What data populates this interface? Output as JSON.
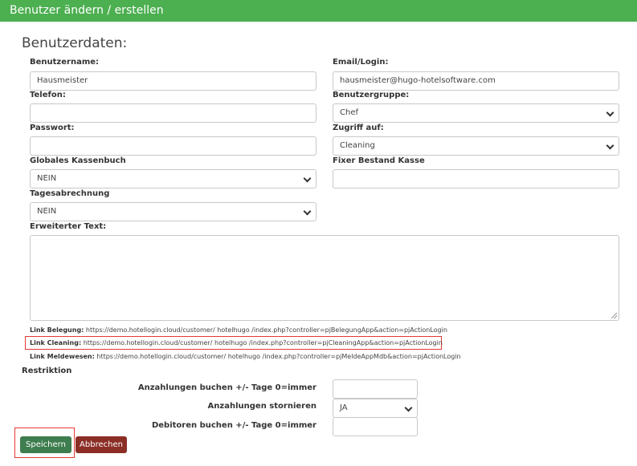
{
  "window": {
    "title": "Benutzer ändern / erstellen"
  },
  "section": {
    "title": "Benutzerdaten:"
  },
  "fields": {
    "benutzername": {
      "label": "Benutzername:",
      "value": "Hausmeister"
    },
    "email": {
      "label": "Email/Login:",
      "value": "hausmeister@hugo-hotelsoftware.com"
    },
    "telefon": {
      "label": "Telefon:",
      "value": ""
    },
    "benutzergruppe": {
      "label": "Benutzergruppe:",
      "value": "Chef"
    },
    "passwort": {
      "label": "Passwort:",
      "value": ""
    },
    "zugriff": {
      "label": "Zugriff auf:",
      "value": "Cleaning"
    },
    "kassenbuch": {
      "label": "Globales Kassenbuch",
      "value": "NEIN"
    },
    "bestand": {
      "label": "Fixer Bestand Kasse",
      "value": ""
    },
    "tagesabrechnung": {
      "label": "Tagesabrechnung",
      "value": "NEIN"
    },
    "erweiterter_text": {
      "label": "Erweiterter Text:",
      "value": ""
    }
  },
  "links": {
    "belegung": {
      "label": "Link Belegung:",
      "prefix": "https://demo.hotellogin.cloud/customer/",
      "customer": "hotelhugo",
      "suffix": "/index.php?controller=pjBelegungApp&action=pjActionLogin"
    },
    "cleaning": {
      "label": "Link Cleaning:",
      "prefix": "https://demo.hotellogin.cloud/customer/",
      "customer": "hotelhugo",
      "suffix": "/index.php?controller=pjCleaningApp&action=pjActionLogin"
    },
    "meldewesen": {
      "label": "Link Meldewesen:",
      "prefix": "https://demo.hotellogin.cloud/customer/",
      "customer": "hotelhugo",
      "suffix": "/index.php?controller=pjMeldeAppMdb&action=pjActionLogin"
    }
  },
  "restriktion": {
    "title": "Restriktion",
    "anzahlungen_buchen": {
      "label": "Anzahlungen buchen +/- Tage 0=immer",
      "value": ""
    },
    "anzahlungen_stornieren": {
      "label": "Anzahlungen stornieren",
      "value": "JA"
    },
    "debitoren_buchen": {
      "label": "Debitoren buchen +/- Tage 0=immer",
      "value": ""
    }
  },
  "buttons": {
    "save": "Speichern",
    "cancel": "Abbrechen"
  },
  "colors": {
    "header": "#4caf50",
    "save": "#3e7d4e",
    "cancel": "#8b2e26",
    "highlight": "#e53935"
  }
}
